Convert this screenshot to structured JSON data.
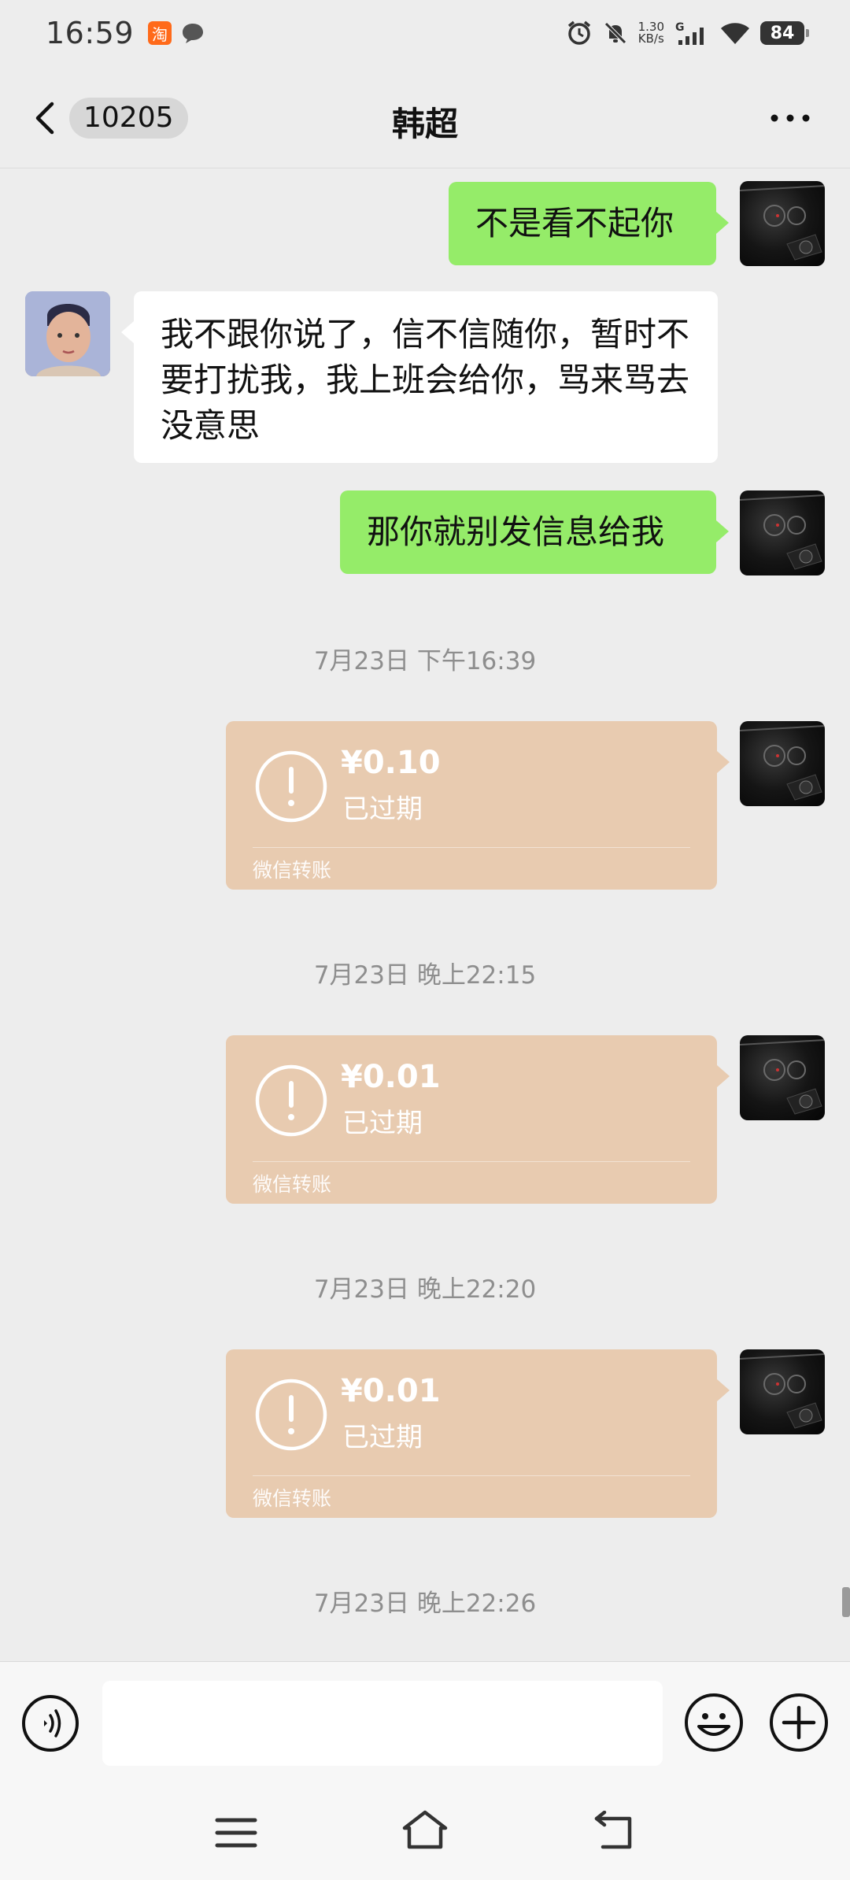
{
  "status_bar": {
    "time": "16:59",
    "net_speed_value": "1.30",
    "net_speed_unit": "KB/s",
    "network": "G",
    "battery": "84",
    "taobao_glyph": "淘"
  },
  "title_bar": {
    "unread_count": "10205",
    "title": "韩超"
  },
  "messages": [
    {
      "from": "self",
      "text": "不是看不起你"
    },
    {
      "from": "friend",
      "text": "我不跟你说了，信不信随你，暂时不要打扰我，我上班会给你，骂来骂去没意思"
    },
    {
      "from": "self",
      "text": "那你就别发信息给我"
    }
  ],
  "timestamps": [
    "7月23日 下午16:39",
    "7月23日 晚上22:15",
    "7月23日 晚上22:20",
    "7月23日 晚上22:26"
  ],
  "transfers": [
    {
      "amount": "¥0.10",
      "status": "已过期",
      "label": "微信转账"
    },
    {
      "amount": "¥0.01",
      "status": "已过期",
      "label": "微信转账"
    },
    {
      "amount": "¥0.01",
      "status": "已过期",
      "label": "微信转账"
    }
  ],
  "input": {
    "value": "",
    "placeholder": ""
  },
  "icons": {
    "back": "chevron-left-icon",
    "more": "more-dots-icon",
    "voice": "voice-icon",
    "emoji": "emoji-icon",
    "plus": "plus-icon",
    "transfer": "exclamation-circle-icon"
  },
  "colors": {
    "self_bubble": "#95ec69",
    "friend_bubble": "#ffffff",
    "transfer_card": "#e8cbb0",
    "background": "#ededed"
  }
}
